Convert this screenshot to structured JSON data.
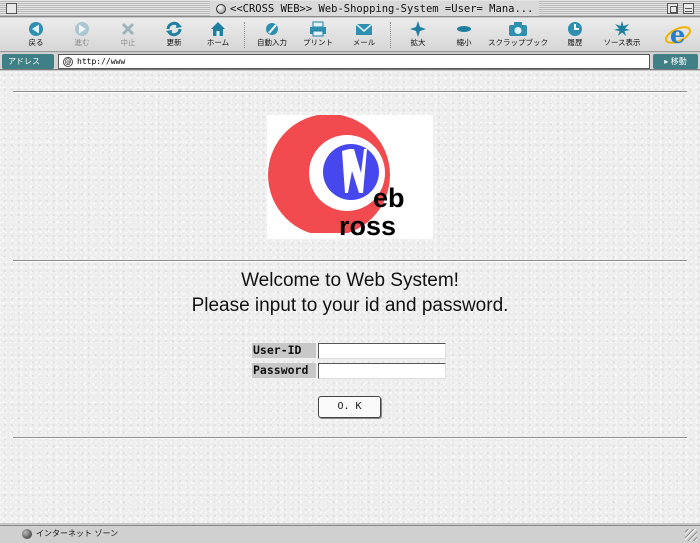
{
  "window": {
    "title": "<<CROSS WEB>> Web-Shopping-System =User= Mana..."
  },
  "toolbar": {
    "buttons": [
      {
        "label": "戻る",
        "icon": "back-arrow-icon"
      },
      {
        "label": "進む",
        "icon": "forward-arrow-icon"
      },
      {
        "label": "中止",
        "icon": "stop-x-icon"
      },
      {
        "label": "更新",
        "icon": "refresh-icon"
      },
      {
        "label": "ホーム",
        "icon": "home-icon"
      },
      {
        "label": "自動入力",
        "icon": "autofill-icon"
      },
      {
        "label": "プリント",
        "icon": "printer-icon"
      },
      {
        "label": "メール",
        "icon": "mail-icon"
      },
      {
        "label": "拡大",
        "icon": "larger-text-icon"
      },
      {
        "label": "縮小",
        "icon": "smaller-text-icon"
      },
      {
        "label": "スクラップブック",
        "icon": "camera-icon"
      },
      {
        "label": "履歴",
        "icon": "history-clock-icon"
      },
      {
        "label": "ソース表示",
        "icon": "view-source-icon"
      }
    ]
  },
  "address": {
    "label": "アドレス",
    "url": "http://www",
    "go_label": "移動"
  },
  "page": {
    "logo_letters": {
      "w_text": "eb",
      "c_text": "ross"
    },
    "welcome_line1": "Welcome to Web System!",
    "welcome_line2": "Please input to your id and password.",
    "userid_label": "User-ID",
    "password_label": "Password",
    "userid_value": "",
    "password_value": "",
    "ok_label": "O. K"
  },
  "status": {
    "text": "インターネット ゾーン"
  },
  "colors": {
    "logo_red": "#f24b4f",
    "logo_blue": "#4747ee",
    "address_teal": "#3f7f86"
  }
}
